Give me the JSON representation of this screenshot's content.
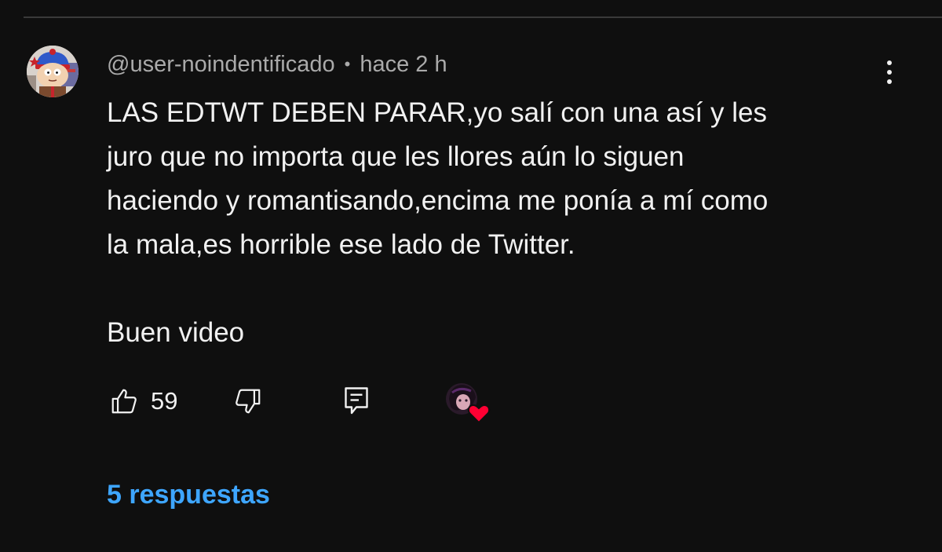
{
  "comment": {
    "author_handle": "@user-noindentificado",
    "separator": "•",
    "time_ago": "hace 2 h",
    "text": "LAS EDTWT DEBEN PARAR,yo salí con una así y les\njuro que no importa que les llores aún lo siguen\nhaciendo y romantisando,encima me ponía a mí como\nla mala,es horrible ese lado de Twitter.\n\nBuen video",
    "like_count": "59",
    "replies_label": "5 respuestas"
  },
  "icons": {
    "like": "thumbs-up-icon",
    "dislike": "thumbs-down-icon",
    "reply": "comment-icon",
    "more": "more-vertical-icon",
    "creator_heart": "heart-icon"
  },
  "colors": {
    "background": "#0f0f0f",
    "text_primary": "#f1f1f1",
    "text_secondary": "#aaaaaa",
    "link_blue": "#3ea6ff",
    "heart_red": "#ff0033"
  }
}
